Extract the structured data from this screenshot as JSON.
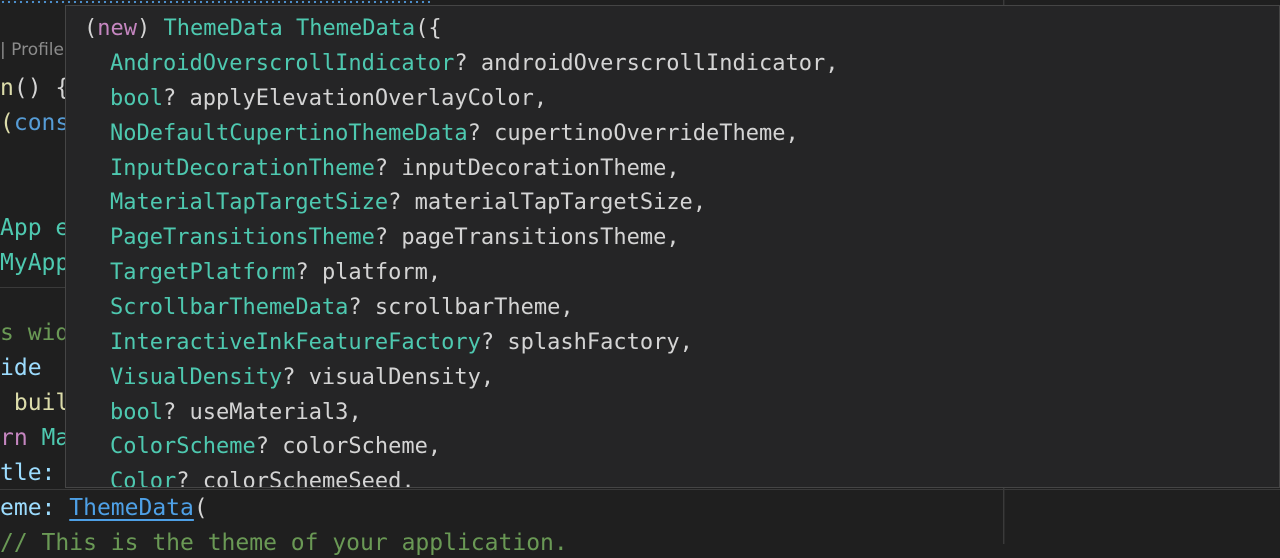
{
  "codelens": "| Profile",
  "editor_lines": [
    {
      "name": "code-line-main",
      "parts": [
        {
          "t": "n",
          "c": "t-yellow"
        },
        {
          "t": "() {",
          "c": "t-white"
        }
      ]
    },
    {
      "name": "code-line-runapp",
      "parts": [
        {
          "t": "(",
          "c": "t-yellow"
        },
        {
          "t": "cons",
          "c": "t-blue"
        }
      ]
    },
    {
      "name": "code-line-class",
      "parts": [
        {
          "t": "App e",
          "c": "t-teal"
        }
      ]
    },
    {
      "name": "code-line-const",
      "parts": [
        {
          "t": "MyApp",
          "c": "t-teal"
        }
      ]
    },
    {
      "name": "code-line-comment-widget",
      "parts": [
        {
          "t": "s wid",
          "c": "t-green"
        }
      ]
    },
    {
      "name": "code-line-override",
      "parts": [
        {
          "t": "ide",
          "c": "t-lblue"
        }
      ]
    },
    {
      "name": "code-line-build",
      "parts": [
        {
          "t": " buil",
          "c": "t-yellow"
        }
      ]
    },
    {
      "name": "code-line-return",
      "parts": [
        {
          "t": "rn ",
          "c": "t-purple"
        },
        {
          "t": "Ma",
          "c": "t-teal"
        }
      ]
    },
    {
      "name": "code-line-title",
      "parts": [
        {
          "t": "tle:",
          "c": "t-lblue"
        }
      ]
    },
    {
      "name": "code-line-theme",
      "parts": [
        {
          "t": "eme: ",
          "c": "t-lblue"
        },
        {
          "t": "ThemeData",
          "c": "link"
        },
        {
          "t": "(",
          "c": "t-white"
        }
      ]
    },
    {
      "name": "code-line-comment-theme",
      "parts": [
        {
          "t": "// This is the theme of your application.",
          "c": "t-green"
        }
      ]
    }
  ],
  "hover": {
    "signature": {
      "new": "new",
      "type": "ThemeData",
      "name": "ThemeData"
    },
    "params": [
      {
        "type": "AndroidOverscrollIndicator",
        "name": "androidOverscrollIndicator"
      },
      {
        "type": "bool",
        "name": "applyElevationOverlayColor"
      },
      {
        "type": "NoDefaultCupertinoThemeData",
        "name": "cupertinoOverrideTheme"
      },
      {
        "type": "InputDecorationTheme",
        "name": "inputDecorationTheme"
      },
      {
        "type": "MaterialTapTargetSize",
        "name": "materialTapTargetSize"
      },
      {
        "type": "PageTransitionsTheme",
        "name": "pageTransitionsTheme"
      },
      {
        "type": "TargetPlatform",
        "name": "platform"
      },
      {
        "type": "ScrollbarThemeData",
        "name": "scrollbarTheme"
      },
      {
        "type": "InteractiveInkFeatureFactory",
        "name": "splashFactory"
      },
      {
        "type": "VisualDensity",
        "name": "visualDensity"
      },
      {
        "type": "bool",
        "name": "useMaterial3"
      },
      {
        "type": "ColorScheme",
        "name": "colorScheme"
      },
      {
        "type": "Color",
        "name": "colorSchemeSeed"
      }
    ]
  }
}
